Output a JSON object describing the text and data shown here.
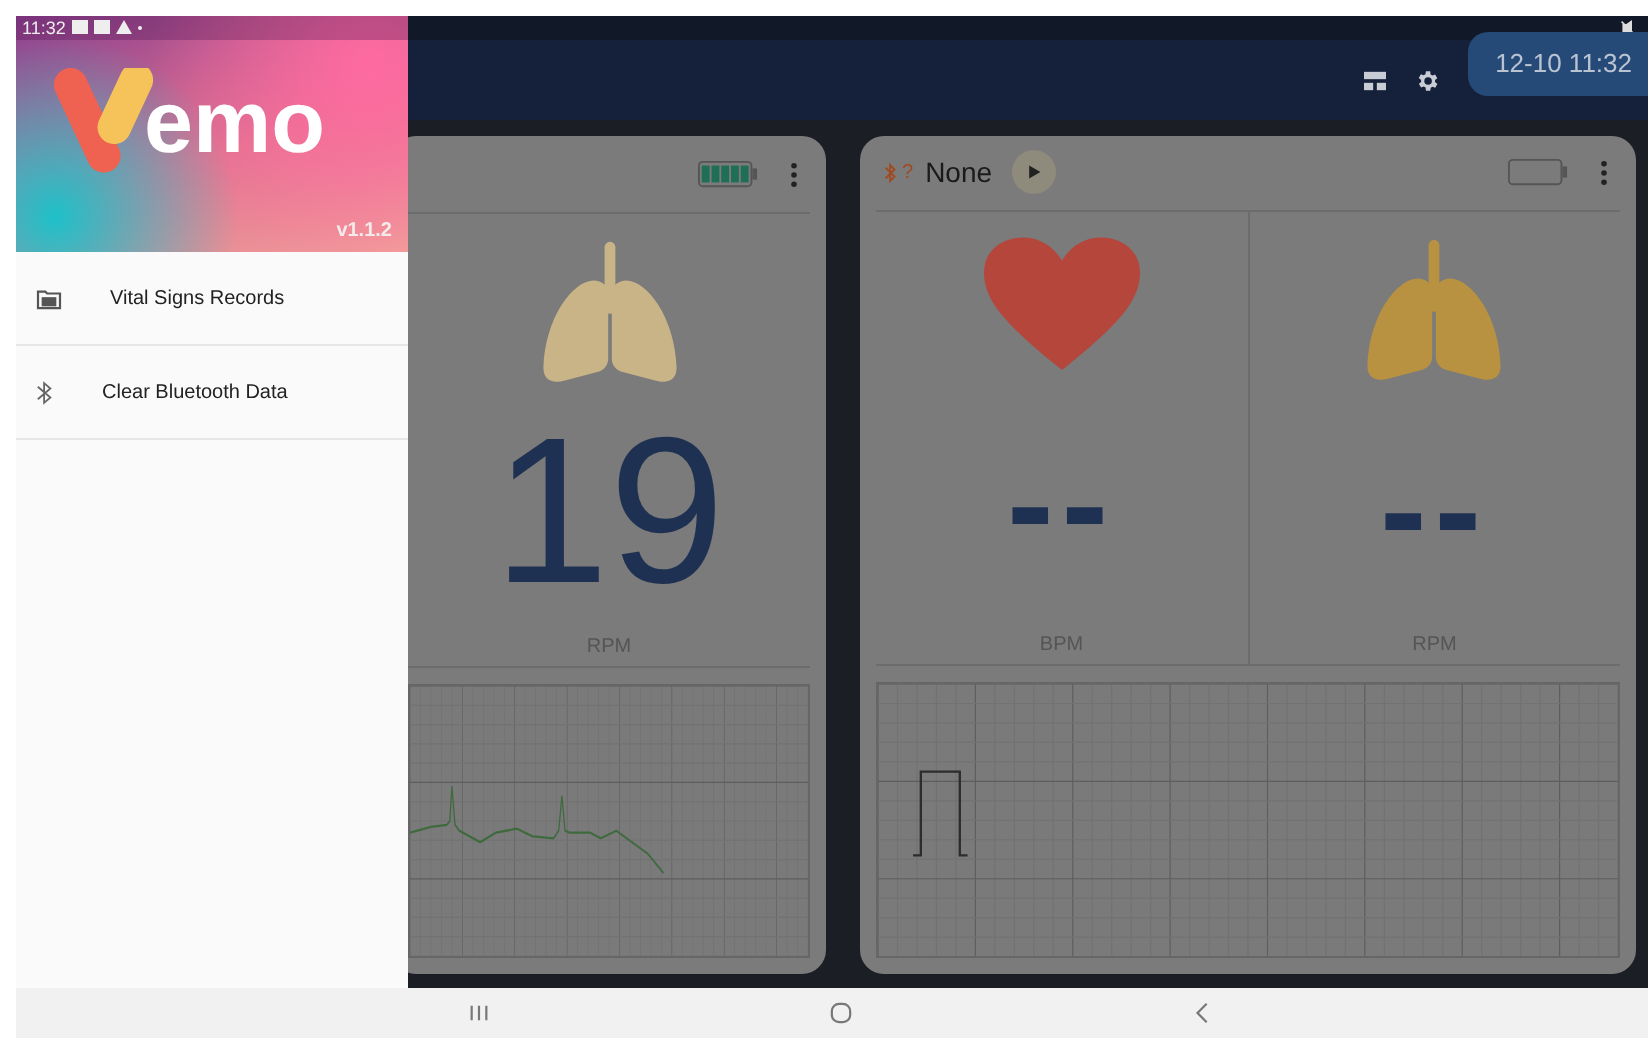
{
  "status_bar": {
    "time": "11:32"
  },
  "drawer": {
    "app_name": "emo",
    "version": "v1.1.2",
    "items": [
      {
        "label": "Vital Signs Records"
      },
      {
        "label": "Clear Bluetooth Data"
      }
    ]
  },
  "header": {
    "datetime": "12-10 11:32"
  },
  "monitors": [
    {
      "battery_charged": true,
      "metrics": [
        {
          "kind": "lungs",
          "value": "19",
          "unit": "RPM"
        }
      ]
    },
    {
      "link_status": "?",
      "device": "None",
      "battery_charged": false,
      "metrics": [
        {
          "kind": "heart",
          "value": "--",
          "unit": "BPM"
        },
        {
          "kind": "lungs",
          "value": "--",
          "unit": "RPM"
        }
      ]
    }
  ]
}
